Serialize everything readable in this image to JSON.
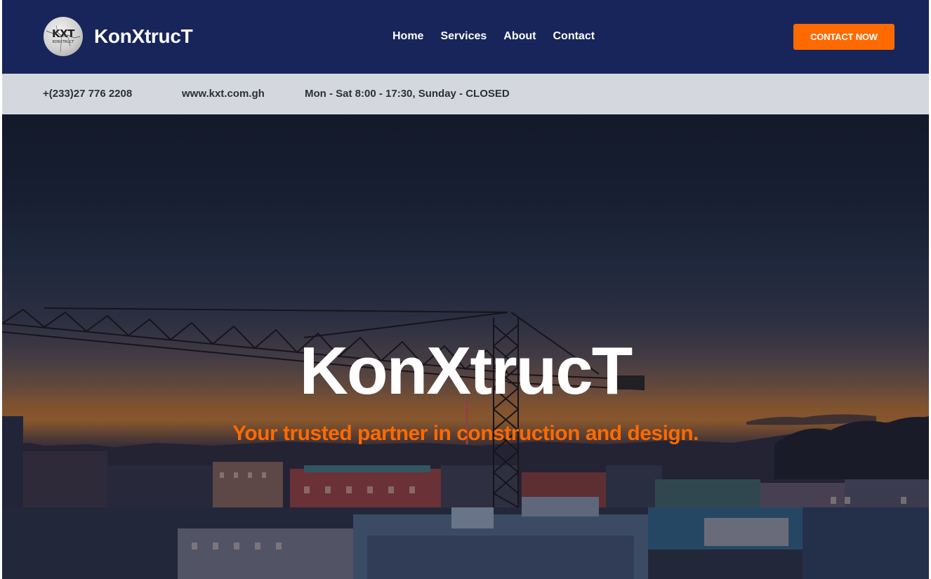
{
  "header": {
    "logo_text": "KXT",
    "logo_subtext": "KONXTRUCT",
    "brand": "KonXtrucT",
    "nav": [
      {
        "label": "Home"
      },
      {
        "label": "Services"
      },
      {
        "label": "About"
      },
      {
        "label": "Contact"
      }
    ],
    "cta_label": "CONTACT NOW"
  },
  "infobar": {
    "phone": "+(233)27 776 2208",
    "website": "www.kxt.com.gh",
    "hours": "Mon - Sat 8:00 - 17:30, Sunday - CLOSED"
  },
  "hero": {
    "title": "KonXtrucT",
    "subtitle": "Your trusted partner in construction and design."
  },
  "colors": {
    "header_bg": "#18255a",
    "accent": "#ff6a00",
    "infobar_bg": "#d4d8de"
  }
}
